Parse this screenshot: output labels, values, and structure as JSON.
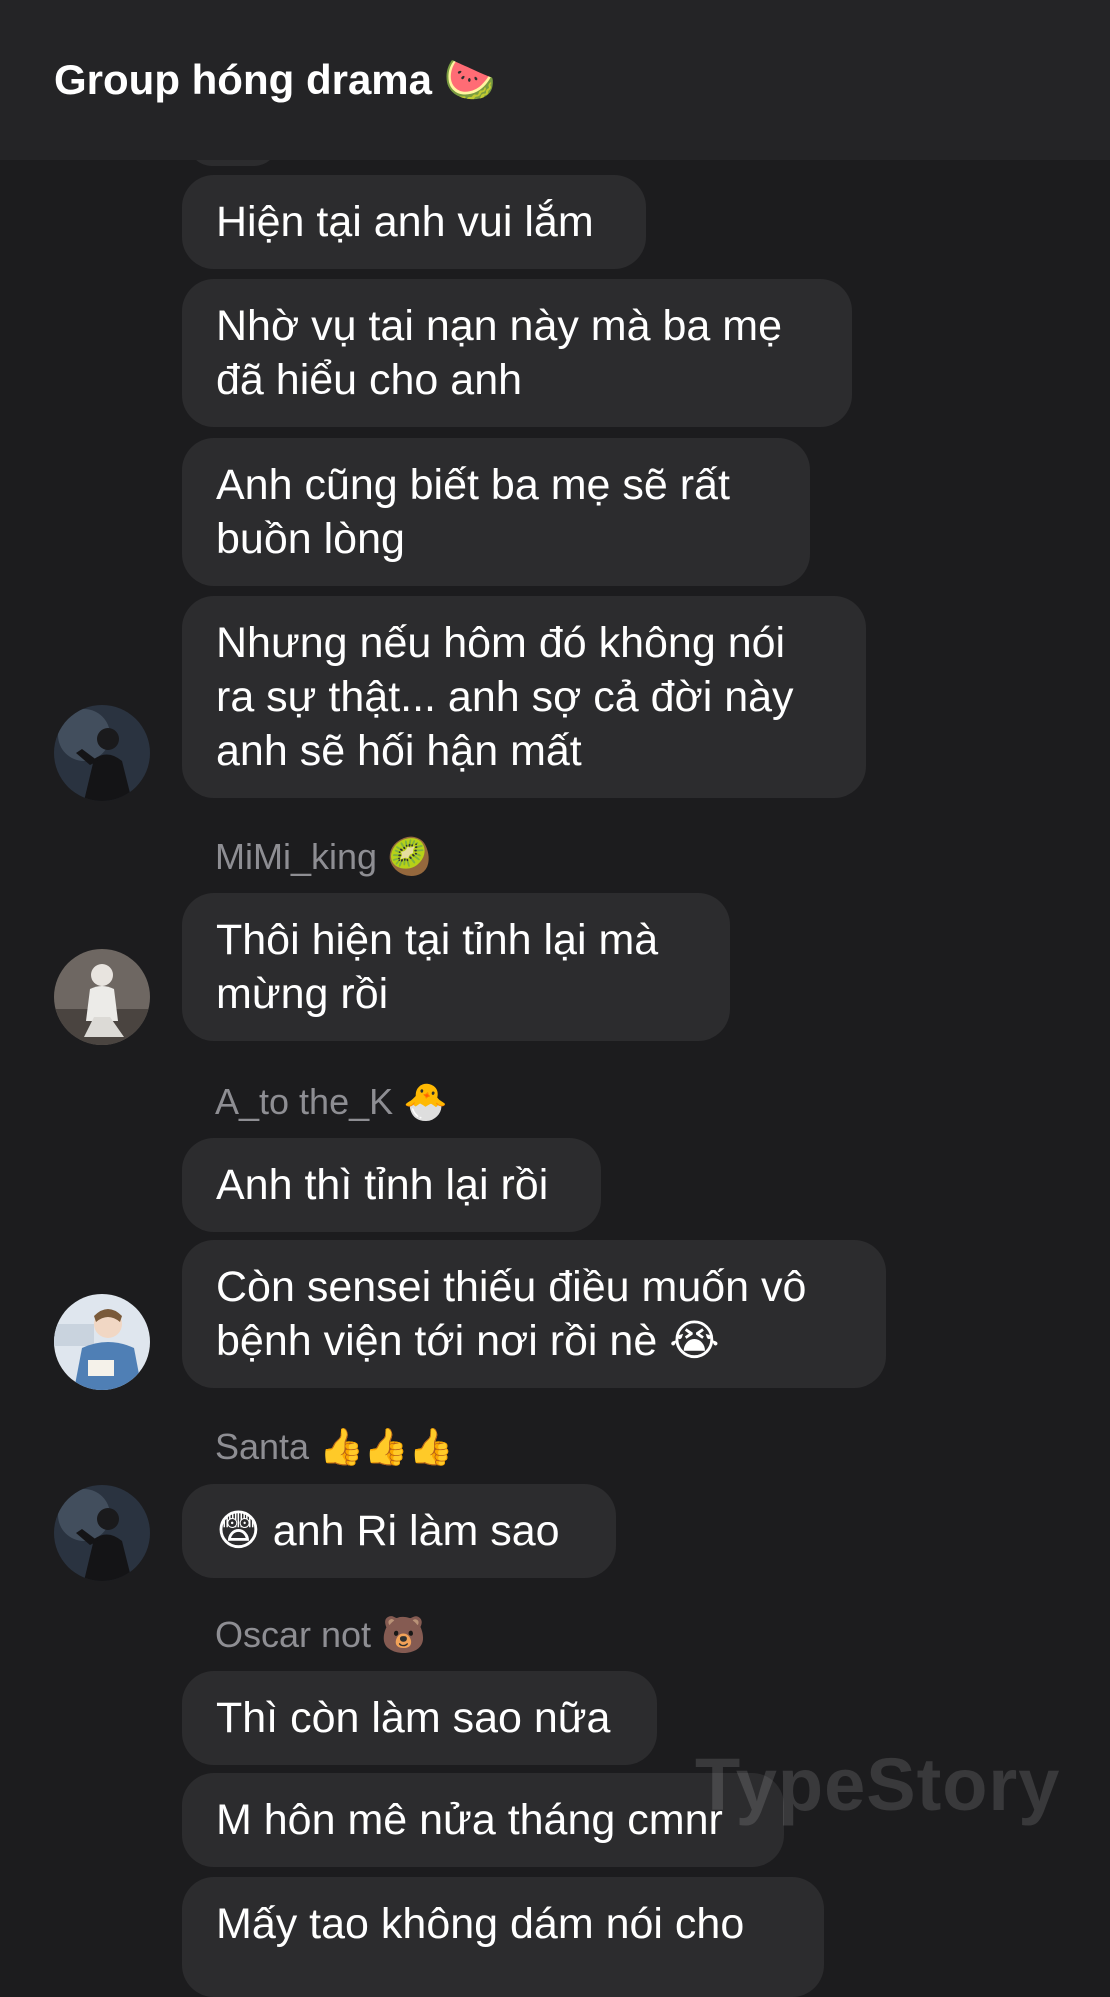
{
  "header": {
    "title": "Group hóng drama 🍉"
  },
  "messages": [
    {
      "lines": [
        "Hiện tại anh vui lắm"
      ]
    },
    {
      "lines": [
        "Nhờ vụ tai nạn này mà ba mẹ",
        "đã hiểu cho anh"
      ]
    },
    {
      "lines": [
        "Anh cũng biết ba mẹ sẽ rất",
        "buồn lòng"
      ]
    },
    {
      "lines": [
        "Nhưng nếu hôm đó không nói",
        "ra sự thật... anh sợ cả đời này",
        "anh sẽ hối hận mất"
      ]
    },
    {
      "sender": "MiMi_king 🥝",
      "lines": [
        "Thôi hiện tại tỉnh lại mà",
        "mừng rồi"
      ]
    },
    {
      "sender": "A_to the_K 🐣",
      "lines": [
        "Anh thì tỉnh lại rồi"
      ]
    },
    {
      "lines": [
        "Còn sensei thiếu điều muốn vô",
        "bệnh viện tới nơi rồi nè 😭"
      ]
    },
    {
      "sender": "Santa 👍👍👍",
      "lines": [
        "😨 anh Ri làm sao"
      ]
    },
    {
      "sender": "Oscar not 🐻",
      "lines": [
        "Thì còn làm sao nữa"
      ]
    },
    {
      "lines": [
        "M hôn mê nửa tháng cmnr"
      ]
    },
    {
      "lines": [
        "Mấy tao không dám nói cho"
      ]
    }
  ],
  "watermark": "TypeStory"
}
